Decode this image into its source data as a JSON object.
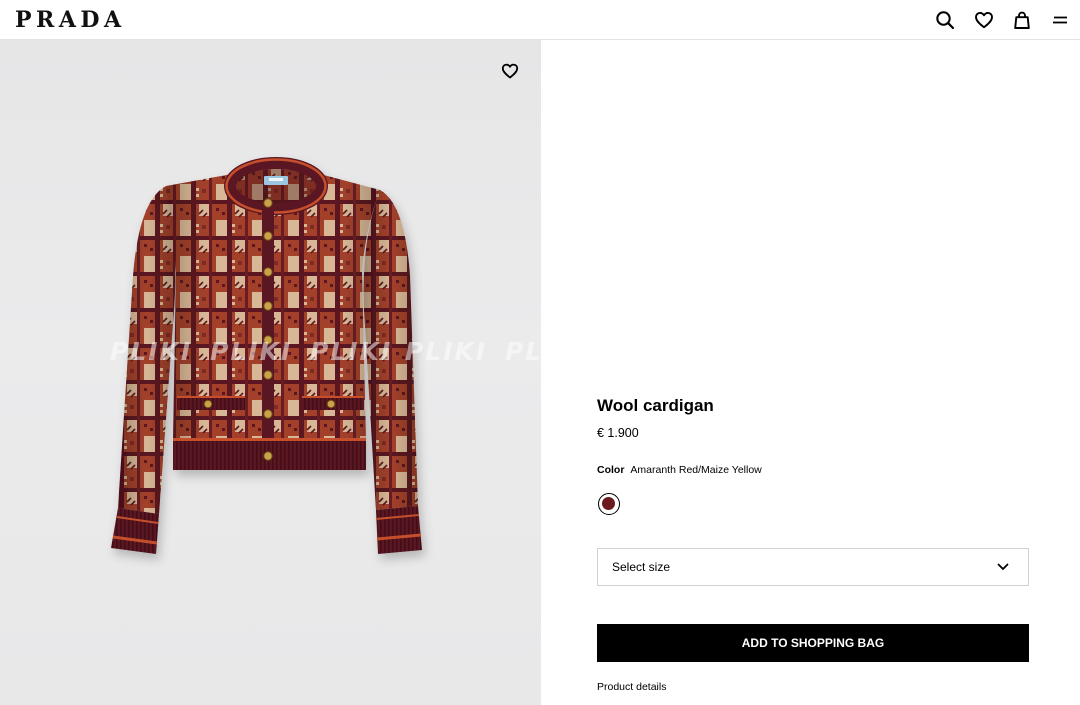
{
  "header": {
    "logo": "PRADA",
    "search_icon": "search-icon",
    "wishlist_icon": "heart-icon",
    "bag_icon": "bag-icon",
    "menu_icon": "menu-icon"
  },
  "gallery": {
    "wishlist_icon": "heart-icon",
    "watermark": "PLIKI"
  },
  "product": {
    "name": "Wool cardigan",
    "price": "€ 1.900",
    "color": {
      "label": "Color",
      "value": "Amaranth Red/Maize Yellow",
      "swatches": [
        {
          "hex": "#6b1a1e",
          "selected": true
        }
      ]
    },
    "size_select": {
      "placeholder": "Select size",
      "chevron_icon": "chevron-down-icon"
    },
    "add_to_bag": "ADD TO SHOPPING BAG",
    "details_link": "Product details"
  },
  "theme": {
    "text": "#000000",
    "button_bg": "#000000",
    "button_text": "#ffffff",
    "gallery_bg": "#e9e9e9",
    "border": "#d2d2d2"
  }
}
